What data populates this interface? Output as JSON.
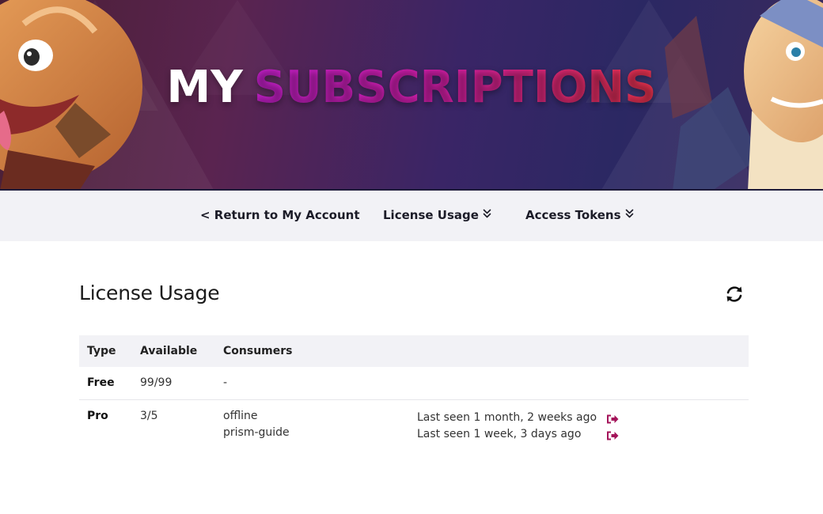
{
  "hero": {
    "title_word1": "MY",
    "title_word2": "SUBSCRIPTIONS"
  },
  "subnav": {
    "return_label": "< Return to My Account",
    "license_label": "License Usage",
    "tokens_label": "Access Tokens",
    "dropdown_icon": "double-chevron-down-icon"
  },
  "license_usage": {
    "title": "License Usage",
    "refresh_icon": "refresh-icon",
    "columns": [
      "Type",
      "Available",
      "Consumers"
    ],
    "rows": [
      {
        "type": "Free",
        "available": "99/99",
        "consumers": [
          {
            "name": "-",
            "last_seen": ""
          }
        ]
      },
      {
        "type": "Pro",
        "available": "3/5",
        "consumers": [
          {
            "name": "offline",
            "last_seen": "Last seen 1 month, 2 weeks ago"
          },
          {
            "name": "prism-guide",
            "last_seen": "Last seen 1 week, 3 days ago"
          }
        ]
      }
    ],
    "revoke_icon": "sign-out-icon",
    "accent_color": "#a4145a"
  }
}
